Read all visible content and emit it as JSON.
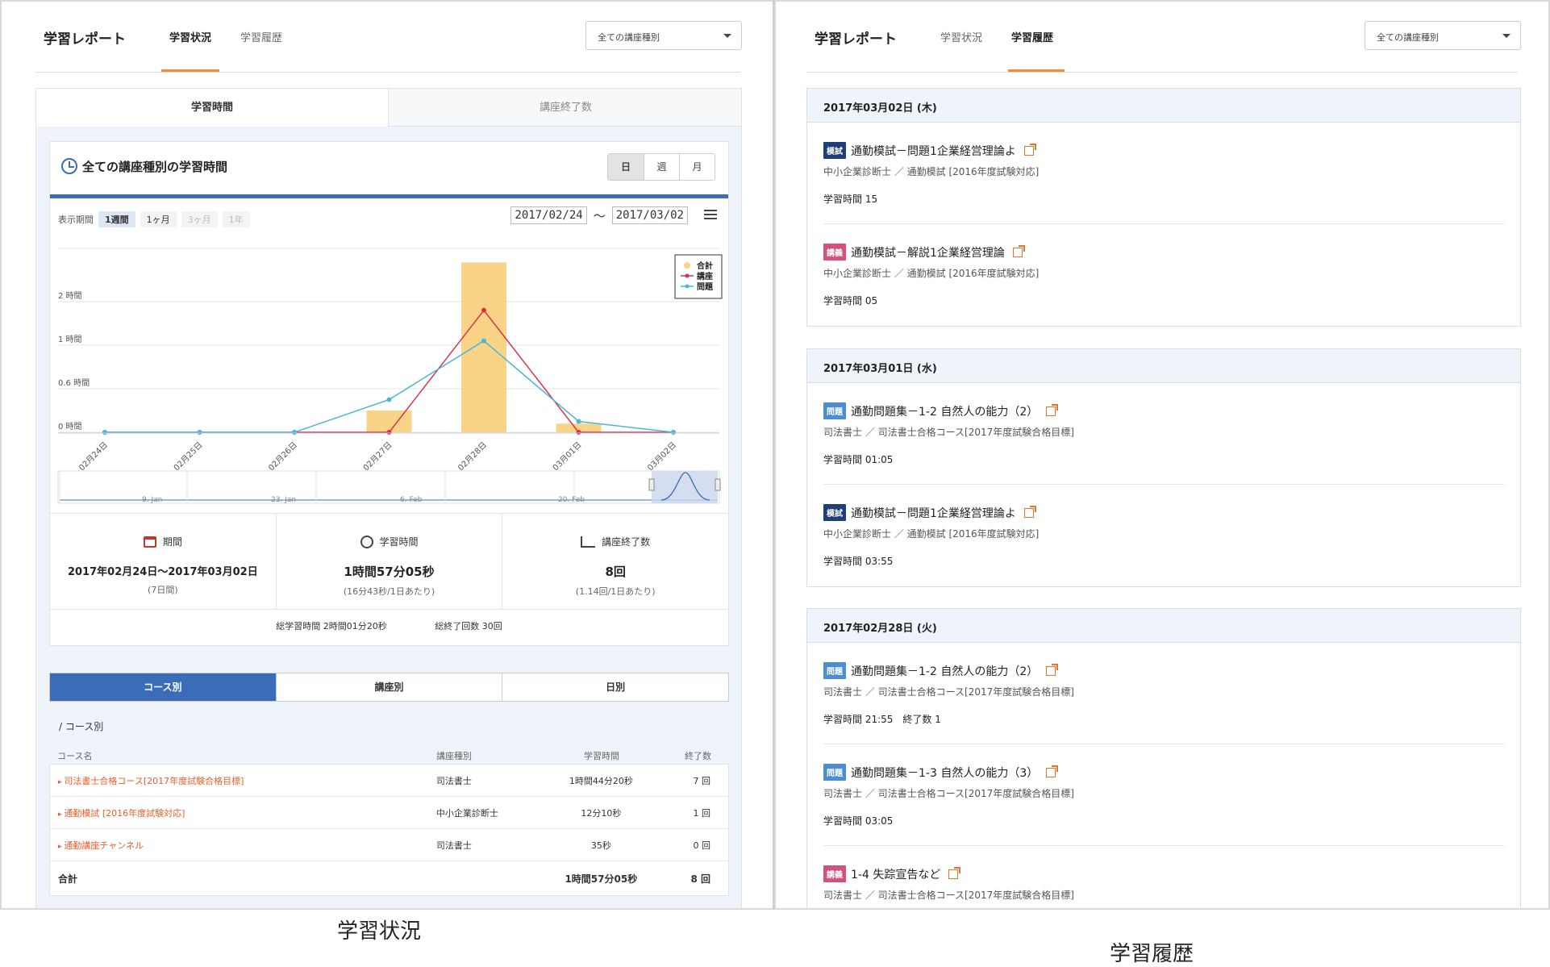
{
  "left": {
    "brand": "学習レポート",
    "tabs": [
      "学習状況",
      "学習履歴"
    ],
    "select": "全ての講座種別",
    "subtabs": [
      "学習時間",
      "講座終了数"
    ],
    "card_title": "全ての講座種別の学習時間",
    "seg": [
      "日",
      "週",
      "月"
    ],
    "period_label": "表示期間",
    "periods": [
      "1週間",
      "1ヶ月",
      "3ヶ月",
      "1年"
    ],
    "date_from": "2017/02/24",
    "date_sep": "〜",
    "date_to": "2017/03/02",
    "stats": {
      "period": {
        "label": "期間",
        "value": "2017年02月24日〜2017年03月02日",
        "sub": "(7日間)"
      },
      "time": {
        "label": "学習時間",
        "value": "1時間57分05秒",
        "sub": "(16分43秒/1日あたり)"
      },
      "count": {
        "label": "講座終了数",
        "value": "8回",
        "sub": "(1.14回/1日あたり)"
      }
    },
    "totals": {
      "time": "総学習時間 2時間01分20秒",
      "count": "総終了回数 30回"
    },
    "bottom_tabs": [
      "コース別",
      "講座別",
      "日別"
    ],
    "crumb": "/ コース別",
    "table": {
      "headers": [
        "コース名",
        "講座種別",
        "学習時間",
        "終了数"
      ],
      "rows": [
        [
          "司法書士合格コース[2017年度試験合格目標]",
          "司法書士",
          "1時間44分20秒",
          "7 回"
        ],
        [
          "通勤模試 [2016年度試験対応]",
          "中小企業診断士",
          "12分10秒",
          "1 回"
        ],
        [
          "通勤講座チャンネル",
          "司法書士",
          "35秒",
          "0 回"
        ]
      ],
      "footer": [
        "合計",
        "",
        "1時間57分05秒",
        "8 回"
      ]
    }
  },
  "chart_data": {
    "type": "bar",
    "categories": [
      "02月24日",
      "02月25日",
      "02月26日",
      "02月27日",
      "02月28日",
      "03月01日",
      "03月02日"
    ],
    "y_ticks": [
      "0 時間",
      "0.6 時間",
      "1 時間",
      "2 時間"
    ],
    "series": [
      {
        "name": "合計",
        "type": "bar",
        "color": "#f9d488",
        "values": [
          0,
          0,
          0,
          0.3,
          2.9,
          0.12,
          0
        ]
      },
      {
        "name": "講座",
        "type": "line",
        "color": "#d9324a",
        "values": [
          0,
          0,
          0,
          0,
          1.8,
          0,
          0
        ]
      },
      {
        "name": "問題",
        "type": "line",
        "color": "#4bb6d6",
        "values": [
          0,
          0,
          0,
          0.45,
          1.1,
          0.15,
          0
        ]
      }
    ],
    "navigator_labels": [
      "9. Jan",
      "23. Jan",
      "6. Feb",
      "20. Feb"
    ],
    "legend": "top-right"
  },
  "right": {
    "brand": "学習レポート",
    "tabs": [
      "学習状況",
      "学習履歴"
    ],
    "select": "全ての講座種別",
    "days": [
      {
        "date": "2017年03月02日 (木)",
        "entries": [
          {
            "badge": "模試",
            "kind": "mock",
            "title": "通勤模試－問題1企業経営理論よ",
            "sub": "中小企業診断士 ／ 通勤模試 [2016年度試験対応]",
            "time": "学習時間 15"
          },
          {
            "badge": "講義",
            "kind": "lec",
            "title": "通勤模試－解説1企業経営理論",
            "sub": "中小企業診断士 ／ 通勤模試 [2016年度試験対応]",
            "time": "学習時間 05"
          }
        ]
      },
      {
        "date": "2017年03月01日 (水)",
        "entries": [
          {
            "badge": "問題",
            "kind": "q",
            "title": "通勤問題集－1-2 自然人の能力（2）",
            "sub": "司法書士 ／ 司法書士合格コース[2017年度試験合格目標]",
            "time": "学習時間 01:05"
          },
          {
            "badge": "模試",
            "kind": "mock",
            "title": "通勤模試－問題1企業経営理論よ",
            "sub": "中小企業診断士 ／ 通勤模試 [2016年度試験対応]",
            "time": "学習時間 03:55"
          }
        ]
      },
      {
        "date": "2017年02月28日 (火)",
        "entries": [
          {
            "badge": "問題",
            "kind": "q",
            "title": "通勤問題集－1-2 自然人の能力（2）",
            "sub": "司法書士 ／ 司法書士合格コース[2017年度試験合格目標]",
            "time": "学習時間 21:55　終了数 1"
          },
          {
            "badge": "問題",
            "kind": "q",
            "title": "通勤問題集－1-3 自然人の能力（3）",
            "sub": "司法書士 ／ 司法書士合格コース[2017年度試験合格目標]",
            "time": "学習時間 03:05"
          },
          {
            "badge": "講義",
            "kind": "lec",
            "title": "1-4 失踪宣告など",
            "sub": "司法書士 ／ 司法書士合格コース[2017年度試験合格目標]",
            "time": ""
          }
        ]
      }
    ]
  },
  "captions": [
    "学習状況",
    "学習履歴"
  ]
}
